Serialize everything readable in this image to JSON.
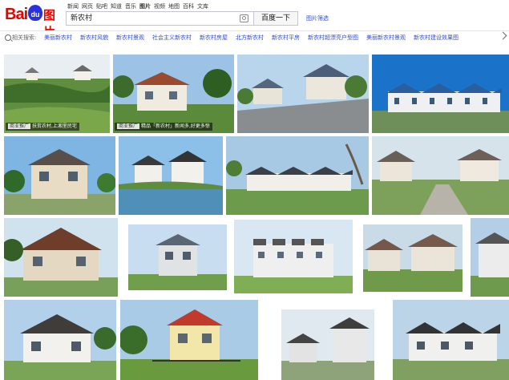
{
  "logo": {
    "bai": "Bai",
    "du": "du",
    "tu": "图片"
  },
  "nav": [
    "新闻",
    "网页",
    "贴吧",
    "知道",
    "音乐",
    "图片",
    "视频",
    "地图",
    "百科",
    "文库"
  ],
  "nav_active_index": 5,
  "search": {
    "value": "新农村",
    "button": "百度一下",
    "switch_label": "图片筛选"
  },
  "filter": {
    "label": "相关搜索:",
    "tags": [
      "美丽新农村",
      "新农村风貌",
      "新农村景观",
      "社会主义新农村",
      "新农村房屋",
      "北方新农村",
      "新农村平房",
      "新农村超漂亮户型图",
      "美丽新农村景观",
      "新农村建设效果图"
    ]
  },
  "tiles": [
    {
      "caption_ad": "商业推广",
      "caption": "扶贫农村,上湘里民宅"
    },
    {
      "caption_ad": "商业推广",
      "caption": "精品「新农村」新闻多,好更多惊"
    },
    {
      "caption_ad": "",
      "caption": ""
    },
    {
      "caption_ad": "",
      "caption": ""
    },
    {
      "caption_ad": "",
      "caption": ""
    },
    {
      "caption_ad": "",
      "caption": ""
    },
    {
      "caption_ad": "",
      "caption": ""
    },
    {
      "caption_ad": "",
      "caption": ""
    },
    {
      "caption_ad": "",
      "caption": ""
    },
    {
      "caption_ad": "",
      "caption": ""
    },
    {
      "caption_ad": "",
      "caption": ""
    },
    {
      "caption_ad": "",
      "caption": ""
    },
    {
      "caption_ad": "",
      "caption": ""
    },
    {
      "caption_ad": "",
      "caption": ""
    },
    {
      "caption_ad": "",
      "caption": ""
    },
    {
      "caption_ad": "",
      "caption": ""
    },
    {
      "caption_ad": "",
      "caption": ""
    },
    {
      "caption_ad": "",
      "caption": ""
    },
    {
      "caption_ad": "",
      "caption": ""
    }
  ],
  "colors": {
    "brand_red": "#e10602",
    "brand_blue": "#2932e1",
    "link_blue": "#2a4be0"
  }
}
